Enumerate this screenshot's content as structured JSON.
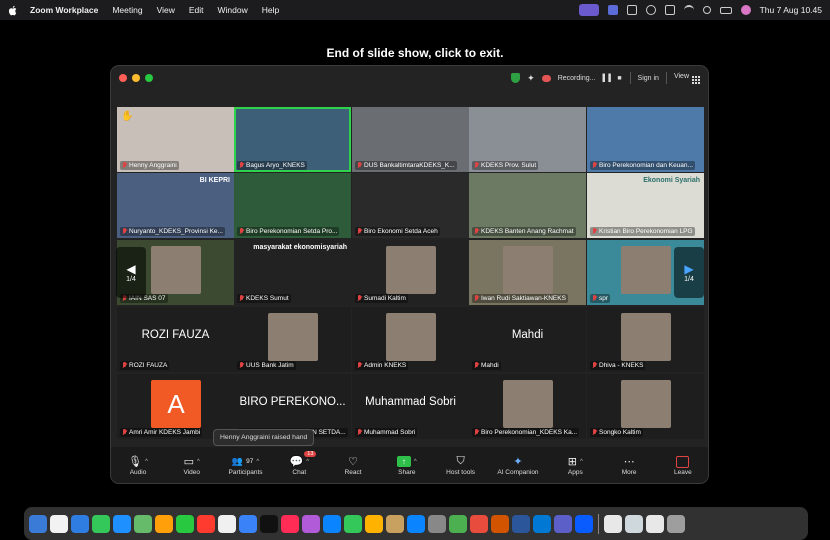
{
  "menubar": {
    "app": "Zoom Workplace",
    "items": [
      "Meeting",
      "View",
      "Edit",
      "Window",
      "Help"
    ],
    "clock": "Thu 7 Aug  10.45"
  },
  "slide_message": "End of slide show, click to exit.",
  "window": {
    "recording_label": "Recording...",
    "pause_label": "▌▌ ■",
    "signin_label": "Sign in",
    "view_label": "View"
  },
  "gallery": {
    "page_indicator": "1/4",
    "tiles": [
      {
        "name": "Henny Anggraini",
        "bg": "#c8c0b8",
        "raise": "✋"
      },
      {
        "name": "Bagus Aryo_KNEKS",
        "bg": "#3d5f78",
        "speaker": true
      },
      {
        "name": "DUS BankaltimtaraKDEKS_K...",
        "bg": "#6a6e72"
      },
      {
        "name": "KDEKS Prov. Sulut",
        "bg": "#8a8f96"
      },
      {
        "name": "Biro Perekonomian dan Keuan...",
        "bg": "#4d7aa8"
      },
      {
        "name": "Nuryanto_KDEKS_Provinsi Ke...",
        "bg": "#4b5f80",
        "overlay": "BI KEPRI"
      },
      {
        "name": "Biro Perekonomian Setda Pro...",
        "bg": "#2e5c3a"
      },
      {
        "name": "Biro Ekonomi Setda Aceh",
        "bg": "#2a2a2a"
      },
      {
        "name": "KDEKS Banten Anang Rachmat",
        "bg": "#6c7a63"
      },
      {
        "name": "Kristian Biro Perekonomian LPG",
        "bg": "#dcdcd4",
        "overlay": "Ekonomi Syariah"
      },
      {
        "name": "IAIN SAS 07",
        "bg": "#3b4a30"
      },
      {
        "name": "KDEKS Sumut",
        "bg": "#222",
        "overlay": "masyarakat ekonomisyariah"
      },
      {
        "name": "Sumadi Kaltim",
        "bg": "#222"
      },
      {
        "name": "Iwan Rudi Saktiawan-KNEKS",
        "bg": "#7a7560"
      },
      {
        "name": "spr",
        "bg": "#3a8a9a"
      },
      {
        "name": "ROZI FAUZA",
        "bg": "#1e1e1e",
        "big": "ROZI FAUZA"
      },
      {
        "name": "UUS Bank Jatim",
        "bg": "#1e1e1e"
      },
      {
        "name": "Admin KNEKS",
        "bg": "#1e1e1e"
      },
      {
        "name": "Mahdi",
        "bg": "#1e1e1e",
        "big": "Mahdi"
      },
      {
        "name": "Dhiva - KNEKS",
        "bg": "#1e1e1e"
      },
      {
        "name": "Amri Amir KDEKS Jambi",
        "bg": "#1e1e1e",
        "letter": "A"
      },
      {
        "name": "BIRO PEREKONOMIAN SETDA...",
        "bg": "#1e1e1e",
        "big": "BIRO PEREKONO..."
      },
      {
        "name": "Muhammad Sobri",
        "bg": "#1e1e1e",
        "big": "Muhammad Sobri"
      },
      {
        "name": "Biro Perekonomian_KDEKS Ka...",
        "bg": "#1e1e1e"
      },
      {
        "name": "Songko Kaltim",
        "bg": "#1e1e1e"
      }
    ]
  },
  "toast": "Henny Anggraini raised hand",
  "toolbar": {
    "audio": "Audio",
    "video": "Video",
    "participants": "Participants",
    "participants_count": "97",
    "chat": "Chat",
    "chat_badge": "13",
    "react": "React",
    "share": "Share",
    "host_tools": "Host tools",
    "ai_companion": "AI Companion",
    "apps": "Apps",
    "more": "More",
    "leave": "Leave"
  },
  "dock_colors": [
    "#3b7bd8",
    "#f2f2f2",
    "#2f7de1",
    "#34c759",
    "#1e90ff",
    "#66bb6a",
    "#ff9f0a",
    "#28c840",
    "#ff3b30",
    "#f0f0f0",
    "#3a82f7",
    "#111111",
    "#ff2d55",
    "#b15bd9",
    "#0a84ff",
    "#34c759",
    "#ffb300",
    "#c8a060",
    "#0a84ff",
    "#888888",
    "#4caf50",
    "#e74c3c",
    "#d35400",
    "#2b579a",
    "#0078d4",
    "#5b5fc7",
    "#0b5cff",
    "#e8e8e8",
    "#cfd8dc",
    "#e8e8e8",
    "#9e9e9e"
  ]
}
